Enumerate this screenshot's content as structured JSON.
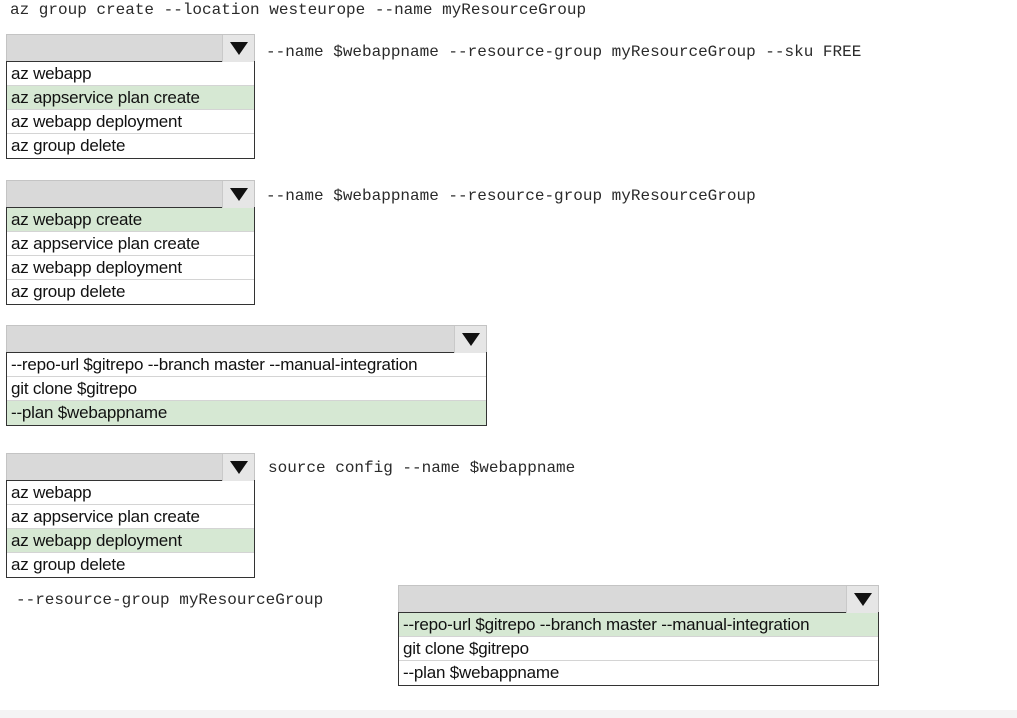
{
  "line1": "az group create --location westeurope --name myResourceGroup",
  "dropdowns": [
    {
      "suffix": "--name $webappname --resource-group myResourceGroup --sku FREE",
      "options": [
        "az webapp",
        "az appservice plan create",
        "az webapp deployment",
        "az group delete"
      ],
      "selected": 1
    },
    {
      "suffix": "--name $webappname --resource-group myResourceGroup",
      "options": [
        "az webapp create",
        "az appservice plan create",
        "az webapp deployment",
        "az group delete"
      ],
      "selected": 0
    },
    {
      "suffix": "",
      "options": [
        "--repo-url $gitrepo --branch master --manual-integration",
        "git clone $gitrepo",
        "--plan $webappname"
      ],
      "selected": 2
    },
    {
      "suffix": "source config --name $webappname",
      "options": [
        "az webapp",
        "az appservice plan create",
        "az webapp deployment",
        "az group delete"
      ],
      "selected": 2
    },
    {
      "prefix": "--resource-group myResourceGroup",
      "options": [
        "--repo-url $gitrepo  --branch master --manual-integration",
        "git clone $gitrepo",
        "--plan $webappname"
      ],
      "selected": 0
    }
  ],
  "icons": {
    "dropdown_arrow": "triangle-down-icon"
  },
  "colors": {
    "selected_option": "#d6e8d3",
    "dropdown_header": "#d9d9d9"
  }
}
